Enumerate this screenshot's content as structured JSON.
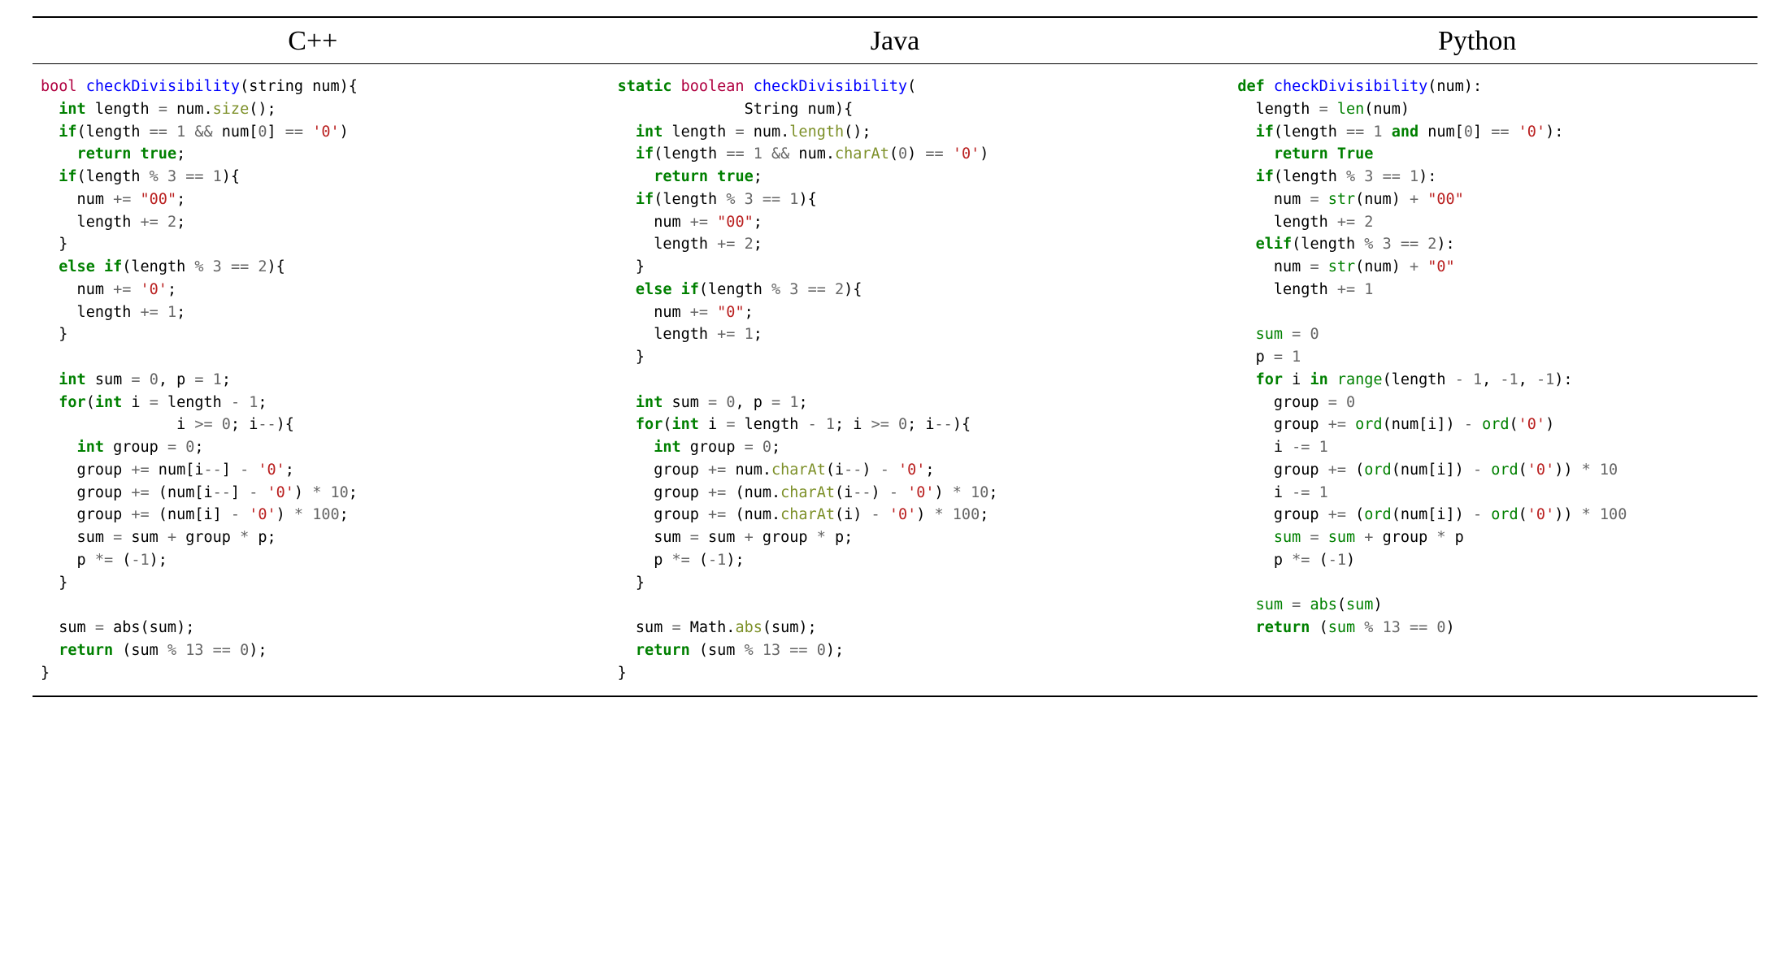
{
  "headers": {
    "cpp": "C++",
    "java": "Java",
    "python": "Python"
  },
  "code": {
    "cpp": {
      "raw": "bool checkDivisibility(string num){\n  int length = num.size();\n  if(length == 1 && num[0] == '0')\n    return true;\n  if(length % 3 == 1){\n    num += \"00\";\n    length += 2;\n  }\n  else if(length % 3 == 2){\n    num += '0';\n    length += 1;\n  }\n\n  int sum = 0, p = 1;\n  for(int i = length - 1;\n               i >= 0; i--){\n    int group = 0;\n    group += num[i--] - '0';\n    group += (num[i--] - '0') * 10;\n    group += (num[i] - '0') * 100;\n    sum = sum + group * p;\n    p *= (-1);\n  }\n\n  sum = abs(sum);\n  return (sum % 13 == 0);\n}"
    },
    "java": {
      "raw": "static boolean checkDivisibility(\n              String num){\n  int length = num.length();\n  if(length == 1 && num.charAt(0) == '0')\n    return true;\n  if(length % 3 == 1){\n    num += \"00\";\n    length += 2;\n  }\n  else if(length % 3 == 2){\n    num += \"0\";\n    length += 1;\n  }\n\n  int sum = 0, p = 1;\n  for(int i = length - 1; i >= 0; i--){\n    int group = 0;\n    group += num.charAt(i--) - '0';\n    group += (num.charAt(i--) - '0') * 10;\n    group += (num.charAt(i) - '0') * 100;\n    sum = sum + group * p;\n    p *= (-1);\n  }\n\n  sum = Math.abs(sum);\n  return (sum % 13 == 0);\n}"
    },
    "python": {
      "raw": "def checkDivisibility(num):\n  length = len(num)\n  if(length == 1 and num[0] == '0'):\n    return True\n  if(length % 3 == 1):\n    num = str(num) + \"00\"\n    length += 2\n  elif(length % 3 == 2):\n    num = str(num) + \"0\"\n    length += 1\n\n  sum = 0\n  p = 1\n  for i in range(length - 1, -1, -1):\n    group = 0\n    group += ord(num[i]) - ord('0')\n    i -= 1\n    group += (ord(num[i]) - ord('0')) * 10\n    i -= 1\n    group += (ord(num[i]) - ord('0')) * 100\n    sum = sum + group * p\n    p *= (-1)\n\n  sum = abs(sum)\n  return (sum % 13 == 0)"
    }
  }
}
